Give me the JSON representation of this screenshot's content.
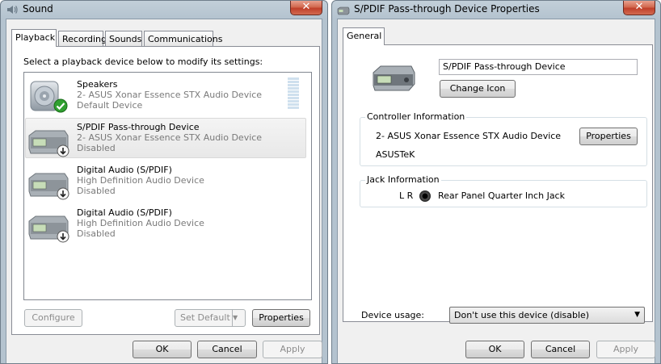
{
  "sound_window": {
    "title": "Sound",
    "close_label": "✕",
    "tabs": [
      {
        "label": "Playback"
      },
      {
        "label": "Recording"
      },
      {
        "label": "Sounds"
      },
      {
        "label": "Communications"
      }
    ],
    "instruction": "Select a playback device below to modify its settings:",
    "devices": [
      {
        "name": "Speakers",
        "description": "2- ASUS Xonar Essence STX Audio Device",
        "status": "Default Device",
        "icon": "speaker-icon",
        "badge": "default-checkmark-icon"
      },
      {
        "name": "S/PDIF Pass-through Device",
        "description": "2- ASUS Xonar Essence STX Audio Device",
        "status": "Disabled",
        "icon": "digital-audio-device-icon",
        "badge": "disabled-arrow-icon"
      },
      {
        "name": "Digital Audio (S/PDIF)",
        "description": "High Definition Audio Device",
        "status": "Disabled",
        "icon": "digital-audio-device-icon",
        "badge": "disabled-arrow-icon"
      },
      {
        "name": "Digital Audio (S/PDIF)",
        "description": "High Definition Audio Device",
        "status": "Disabled",
        "icon": "digital-audio-device-icon",
        "badge": "disabled-arrow-icon"
      }
    ],
    "configure_label": "Configure",
    "set_default_label": "Set Default",
    "properties_label": "Properties",
    "ok_label": "OK",
    "cancel_label": "Cancel",
    "apply_label": "Apply"
  },
  "properties_window": {
    "title": "S/PDIF Pass-through Device Properties",
    "close_label": "✕",
    "tabs": [
      {
        "label": "General"
      }
    ],
    "device_name_value": "S/PDIF Pass-through Device",
    "change_icon_label": "Change Icon",
    "controller_group_label": "Controller Information",
    "controller_name": "2- ASUS Xonar Essence STX Audio Device",
    "controller_vendor": "ASUSTeK",
    "properties_label": "Properties",
    "jack_group_label": "Jack Information",
    "jack_channels": "L R",
    "jack_name": "Rear Panel Quarter Inch Jack",
    "device_usage_label": "Device usage:",
    "device_usage_value": "Don't use this device (disable)",
    "ok_label": "OK",
    "cancel_label": "Cancel",
    "apply_label": "Apply"
  },
  "colors": {
    "title_bar": "#b4c3cf",
    "close_button": "#c0402a",
    "selected_row": "#e8e8e8",
    "disabled_text": "#7a7a7a"
  }
}
